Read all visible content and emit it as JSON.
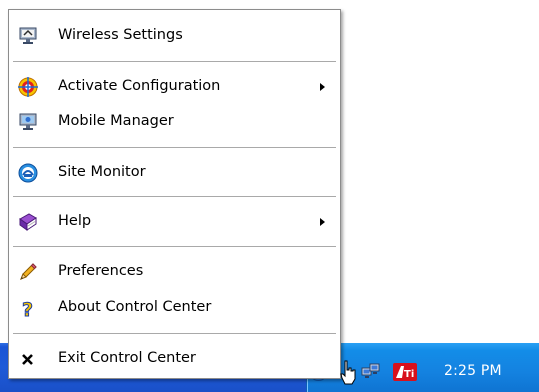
{
  "menu": {
    "items": [
      {
        "label": "Wireless Settings",
        "icon": "wireless-settings-icon"
      },
      {
        "label": "Activate Configuration",
        "icon": "activate-configuration-icon",
        "submenu": true
      },
      {
        "label": "Mobile Manager",
        "icon": "mobile-manager-icon"
      },
      {
        "label": "Site Monitor",
        "icon": "site-monitor-icon"
      },
      {
        "label": "Help",
        "icon": "help-book-icon",
        "submenu": true
      },
      {
        "label": "Preferences",
        "icon": "pencil-icon"
      },
      {
        "label": "About Control Center",
        "icon": "question-mark-icon"
      },
      {
        "label": "Exit Control Center",
        "icon": "x-icon"
      }
    ]
  },
  "taskbar": {
    "clock": "2:25 PM",
    "tray_icons": [
      "show-hidden-icons-chevron",
      "network-icon",
      "ati-icon"
    ]
  },
  "colors": {
    "taskbar_blue": "#1d5ad8",
    "tray_blue": "#1482e0",
    "menu_border": "#8c8c8c",
    "separator": "#a9a9a9"
  }
}
